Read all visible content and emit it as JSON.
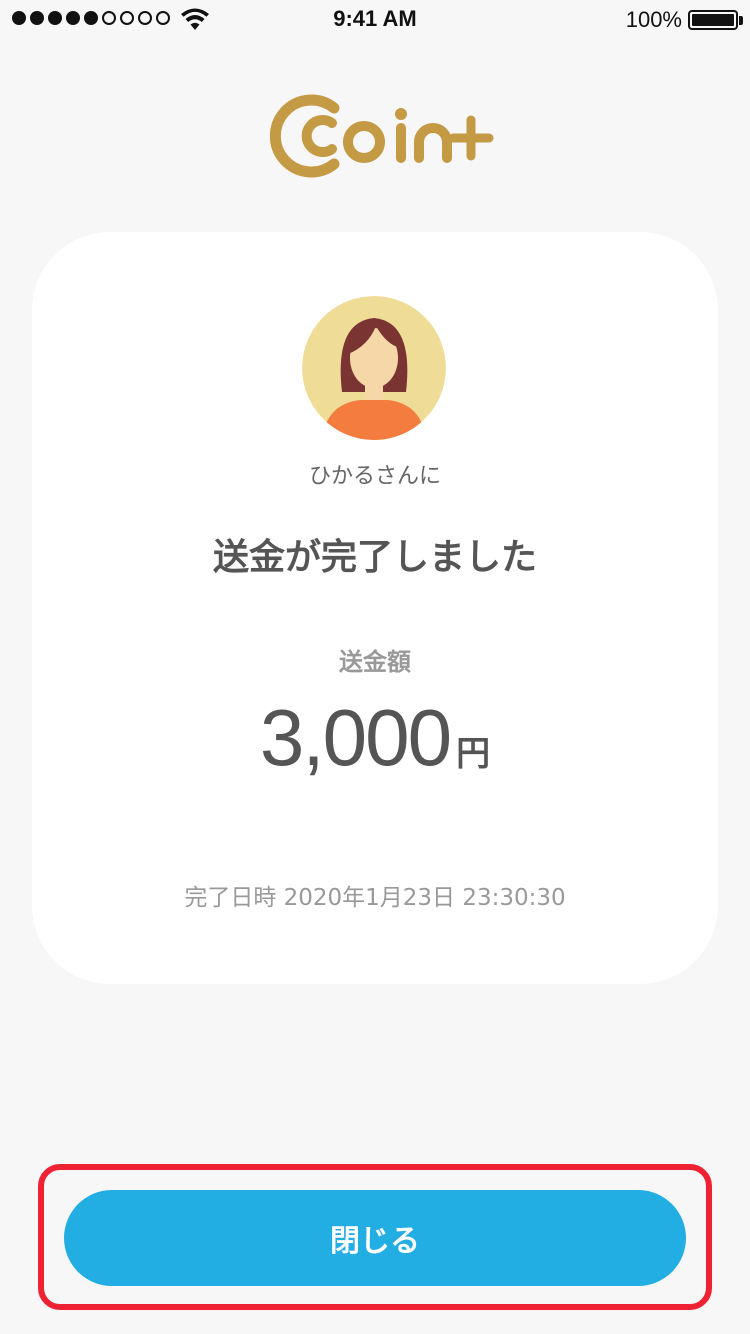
{
  "status_bar": {
    "time": "9:41 AM",
    "battery": "100%",
    "signal_bars_filled": 5,
    "signal_bars_total": 9,
    "icons": [
      "signal-dots-icon",
      "wifi-icon",
      "battery-icon"
    ]
  },
  "brand": {
    "logo_name": "coin+",
    "color": "#c49a45"
  },
  "card": {
    "recipient": "ひかるさんに",
    "headline": "送金が完了しました",
    "amount_label": "送金額",
    "amount_value": "3,000",
    "amount_unit": "円",
    "completed_at": "完了日時 2020年1月23日 23:30:30"
  },
  "actions": {
    "close_label": "閉じる",
    "button_color": "#22ade3",
    "highlight_color": "#ee2233"
  }
}
